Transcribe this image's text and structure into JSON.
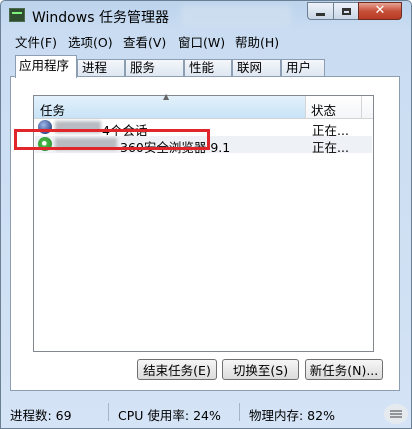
{
  "window": {
    "title": "Windows 任务管理器"
  },
  "menu": [
    "文件(F)",
    "选项(O)",
    "查看(V)",
    "窗口(W)",
    "帮助(H)"
  ],
  "tabs": [
    "应用程序",
    "进程",
    "服务",
    "性能",
    "联网",
    "用户"
  ],
  "list": {
    "headers": {
      "task": "任务",
      "status": "状态"
    },
    "rows": [
      {
        "task": "4个会话",
        "status": "正在...",
        "icon": "globe-icon"
      },
      {
        "task": "360安全浏览器 9.1",
        "status": "正在...",
        "icon": "360-browser-icon"
      }
    ]
  },
  "buttons": {
    "end_task": "结束任务(E)",
    "switch_to": "切换至(S)",
    "new_task": "新任务(N)..."
  },
  "statusbar": {
    "processes": "进程数: 69",
    "cpu": "CPU 使用率: 24%",
    "memory": "物理内存: 82%"
  },
  "colors": {
    "highlight": "#e1262b",
    "titlebar": "#bcd3ec",
    "close": "#c7503a"
  }
}
